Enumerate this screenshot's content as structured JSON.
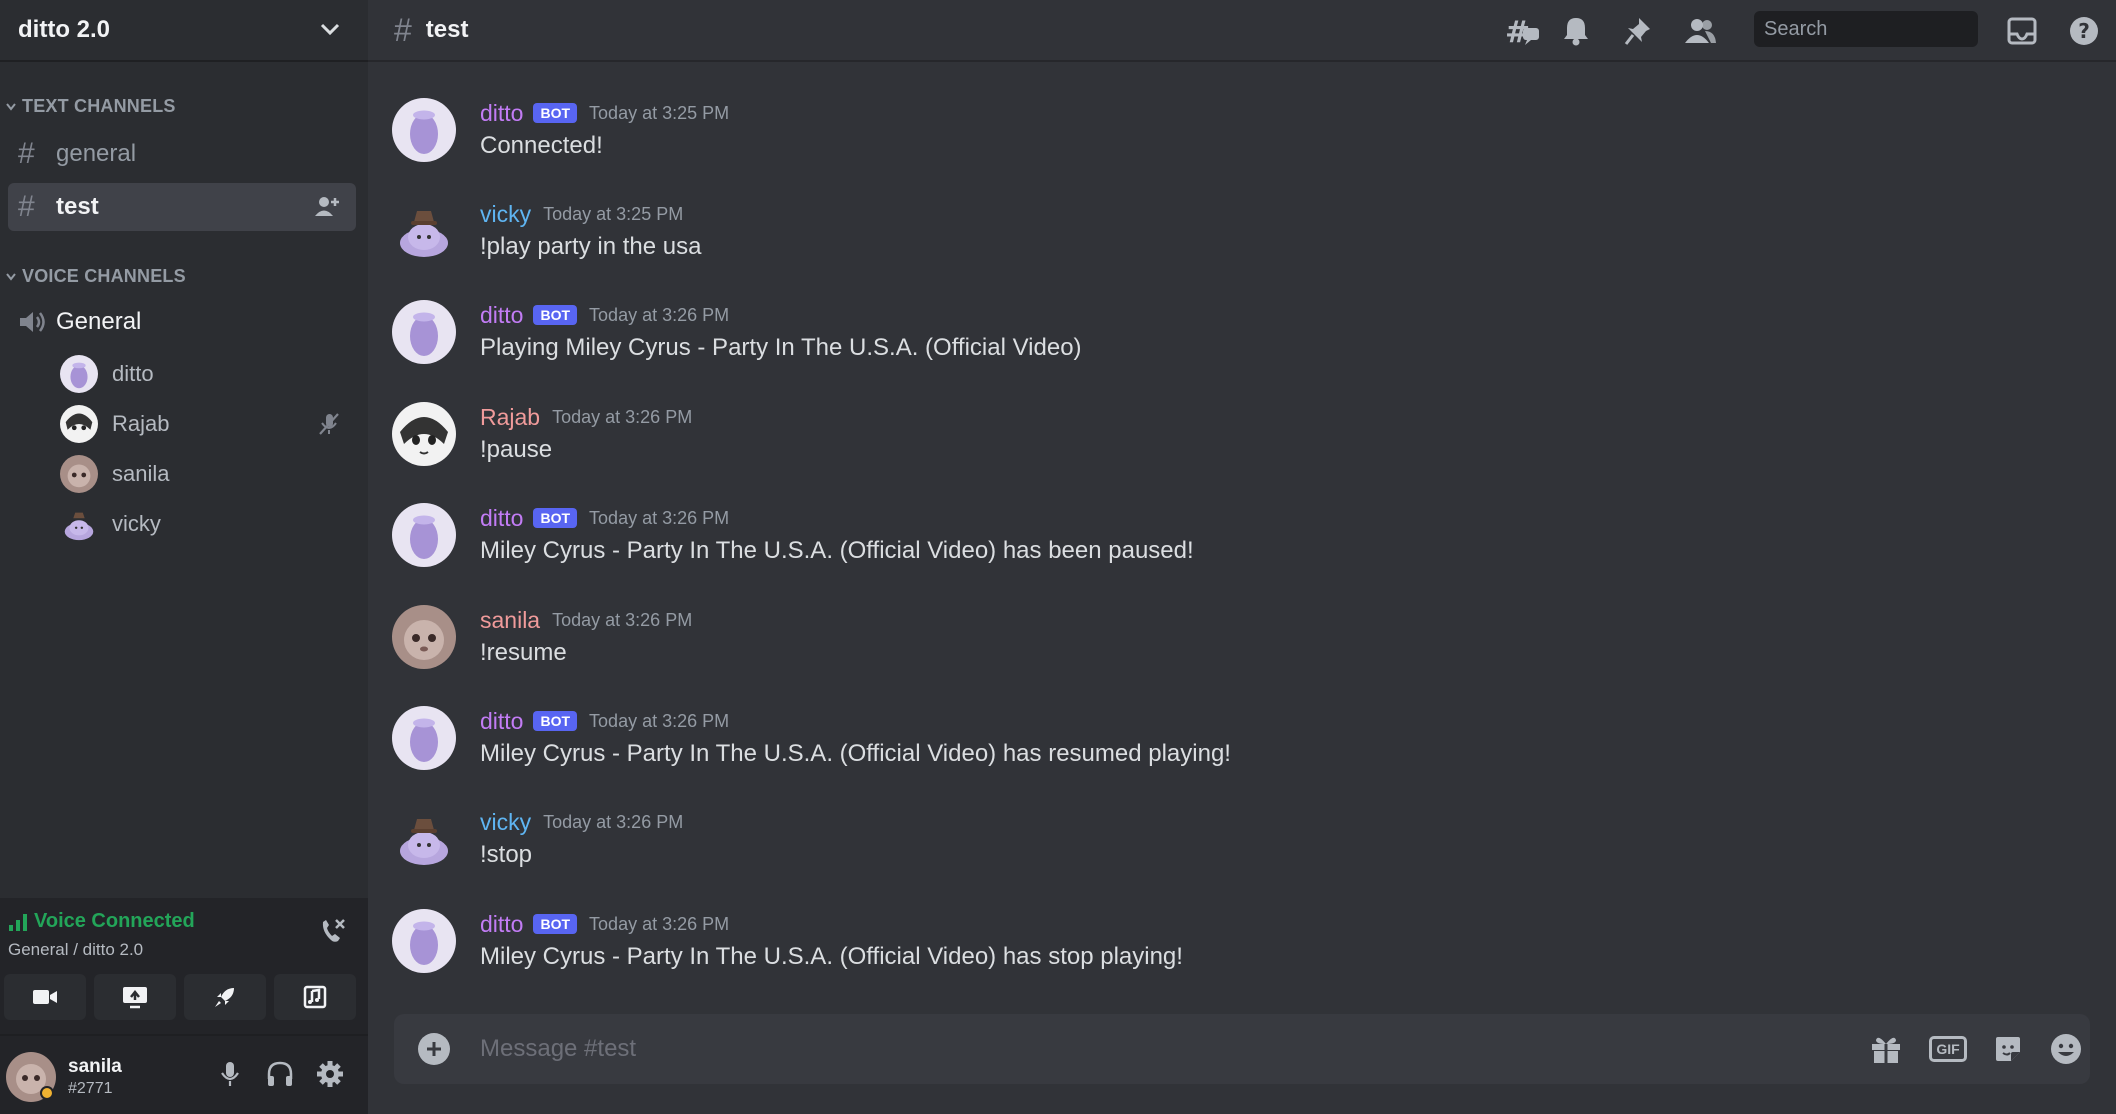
{
  "server": {
    "name": "ditto 2.0"
  },
  "categories": {
    "text": "TEXT CHANNELS",
    "voice": "VOICE CHANNELS"
  },
  "text_channels": [
    {
      "name": "general",
      "active": false
    },
    {
      "name": "test",
      "active": true
    }
  ],
  "voice_channel": {
    "name": "General",
    "users": [
      {
        "name": "ditto",
        "avatar": "ditto-blob"
      },
      {
        "name": "Rajab",
        "avatar": "manga-face",
        "status_icon": "mic-muted-icon"
      },
      {
        "name": "sanila",
        "avatar": "fuzzy-face"
      },
      {
        "name": "vicky",
        "avatar": "ditto-hat"
      }
    ]
  },
  "voice_panel": {
    "status": "Voice Connected",
    "location": "General / ditto 2.0"
  },
  "user_panel": {
    "name": "sanila",
    "tag": "#2771"
  },
  "channel_header": {
    "hash": "#",
    "name": "test"
  },
  "search": {
    "placeholder": "Search"
  },
  "messages": [
    {
      "author": "ditto",
      "bot": true,
      "bot_label": "BOT",
      "time": "Today at 3:25 PM",
      "text": "Connected!",
      "color": "#c27cf5",
      "avatar": "ditto-blob"
    },
    {
      "author": "vicky",
      "bot": false,
      "time": "Today at 3:25 PM",
      "text": "!play party in the usa",
      "color": "#5fb5f2",
      "avatar": "ditto-hat"
    },
    {
      "author": "ditto",
      "bot": true,
      "bot_label": "BOT",
      "time": "Today at 3:26 PM",
      "text": "Playing Miley Cyrus - Party In The U.S.A. (Official Video)",
      "color": "#c27cf5",
      "avatar": "ditto-blob"
    },
    {
      "author": "Rajab",
      "bot": false,
      "time": "Today at 3:26 PM",
      "text": "!pause",
      "color": "#f09b9b",
      "avatar": "manga-face"
    },
    {
      "author": "ditto",
      "bot": true,
      "bot_label": "BOT",
      "time": "Today at 3:26 PM",
      "text": "Miley Cyrus - Party In The U.S.A. (Official Video) has been paused!",
      "color": "#c27cf5",
      "avatar": "ditto-blob"
    },
    {
      "author": "sanila",
      "bot": false,
      "time": "Today at 3:26 PM",
      "text": "!resume",
      "color": "#f09b9b",
      "avatar": "fuzzy-face"
    },
    {
      "author": "ditto",
      "bot": true,
      "bot_label": "BOT",
      "time": "Today at 3:26 PM",
      "text": "Miley Cyrus - Party In The U.S.A. (Official Video) has resumed playing!",
      "color": "#c27cf5",
      "avatar": "ditto-blob"
    },
    {
      "author": "vicky",
      "bot": false,
      "time": "Today at 3:26 PM",
      "text": "!stop",
      "color": "#5fb5f2",
      "avatar": "ditto-hat"
    },
    {
      "author": "ditto",
      "bot": true,
      "bot_label": "BOT",
      "time": "Today at 3:26 PM",
      "text": "Miley Cyrus - Party In The U.S.A. (Official Video) has stop playing!",
      "color": "#c27cf5",
      "avatar": "ditto-blob"
    }
  ],
  "composer": {
    "placeholder": "Message #test",
    "gif_label": "GIF"
  },
  "colors": {
    "accent": "#5865f2",
    "voice_green": "#23a559",
    "background": "#313338",
    "sidebar": "#2b2d31"
  }
}
